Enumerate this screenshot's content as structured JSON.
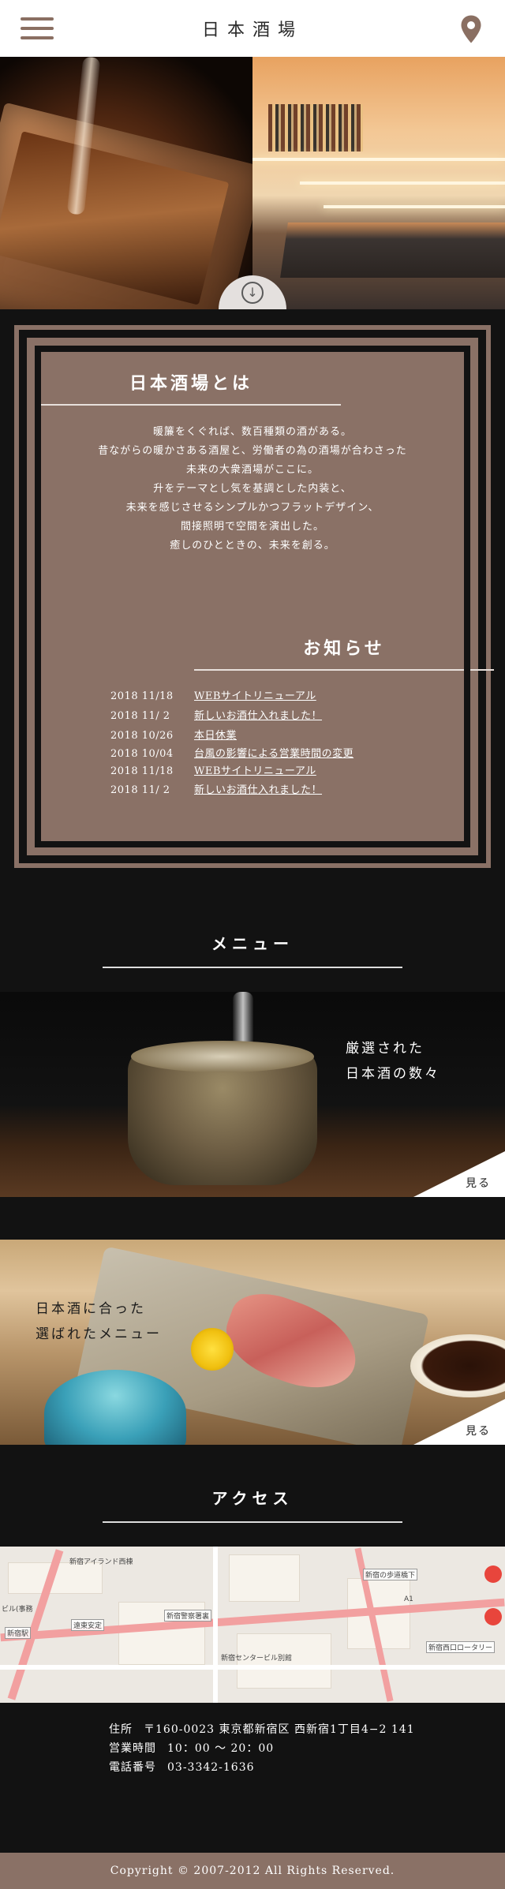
{
  "header": {
    "title": "日本酒場",
    "menu_icon": "hamburger-icon",
    "location_icon": "map-pin-icon",
    "accent_color": "#8a6f62"
  },
  "hero": {
    "scroll_icon": "arrow-down-circle-icon"
  },
  "about": {
    "title": "日本酒場とは",
    "lines": [
      "暖簾をくぐれば、数百種類の酒がある。",
      "昔ながらの暖かさある酒屋と、労働者の為の酒場が合わさった",
      "未来の大衆酒場がここに。",
      "升をテーマとし気を基調とした内装と、",
      "未来を感じさせるシンプルかつフラットデザイン、",
      "間接照明で空間を演出した。",
      "癒しのひとときの、未来を創る。"
    ]
  },
  "news": {
    "title": "お知らせ",
    "items": [
      {
        "date": "2018 11/18",
        "text": "WEBサイトリニューアル"
      },
      {
        "date": "2018 11/ 2",
        "text": "新しいお酒仕入れました！"
      },
      {
        "date": "2018 10/26",
        "text": "本日休業"
      },
      {
        "date": "2018 10/04",
        "text": "台風の影響による営業時間の変更"
      },
      {
        "date": "2018 11/18",
        "text": "WEBサイトリニューアル"
      },
      {
        "date": "2018 11/ 2",
        "text": "新しいお酒仕入れました！"
      }
    ]
  },
  "menu": {
    "title": "メニュー",
    "cards": [
      {
        "line1": "厳選された",
        "line2": "日本酒の数々",
        "more": "見る"
      },
      {
        "line1": "日本酒に合った",
        "line2": "選ばれたメニュー",
        "more": "見る"
      }
    ]
  },
  "access": {
    "title": "アクセス",
    "map_labels": [
      "新宿アイランド西棟",
      "ビル(事務",
      "新宿駅",
      "遠東安定",
      "新宿警察署裏",
      "新宿センタービル別館",
      "新宿の歩道橋下",
      "新宿西口ロータリー",
      "A1"
    ]
  },
  "info": {
    "address_label": "住所",
    "address": "〒160-0023 東京都新宿区 西新宿1丁目4−2 141",
    "hours_label": "営業時間",
    "hours": "10：00 〜 20：00",
    "phone_label": "電話番号",
    "phone": "03-3342-1636"
  },
  "footer": {
    "copyright": "Copyright © 2007-2012 All Rights Reserved."
  }
}
